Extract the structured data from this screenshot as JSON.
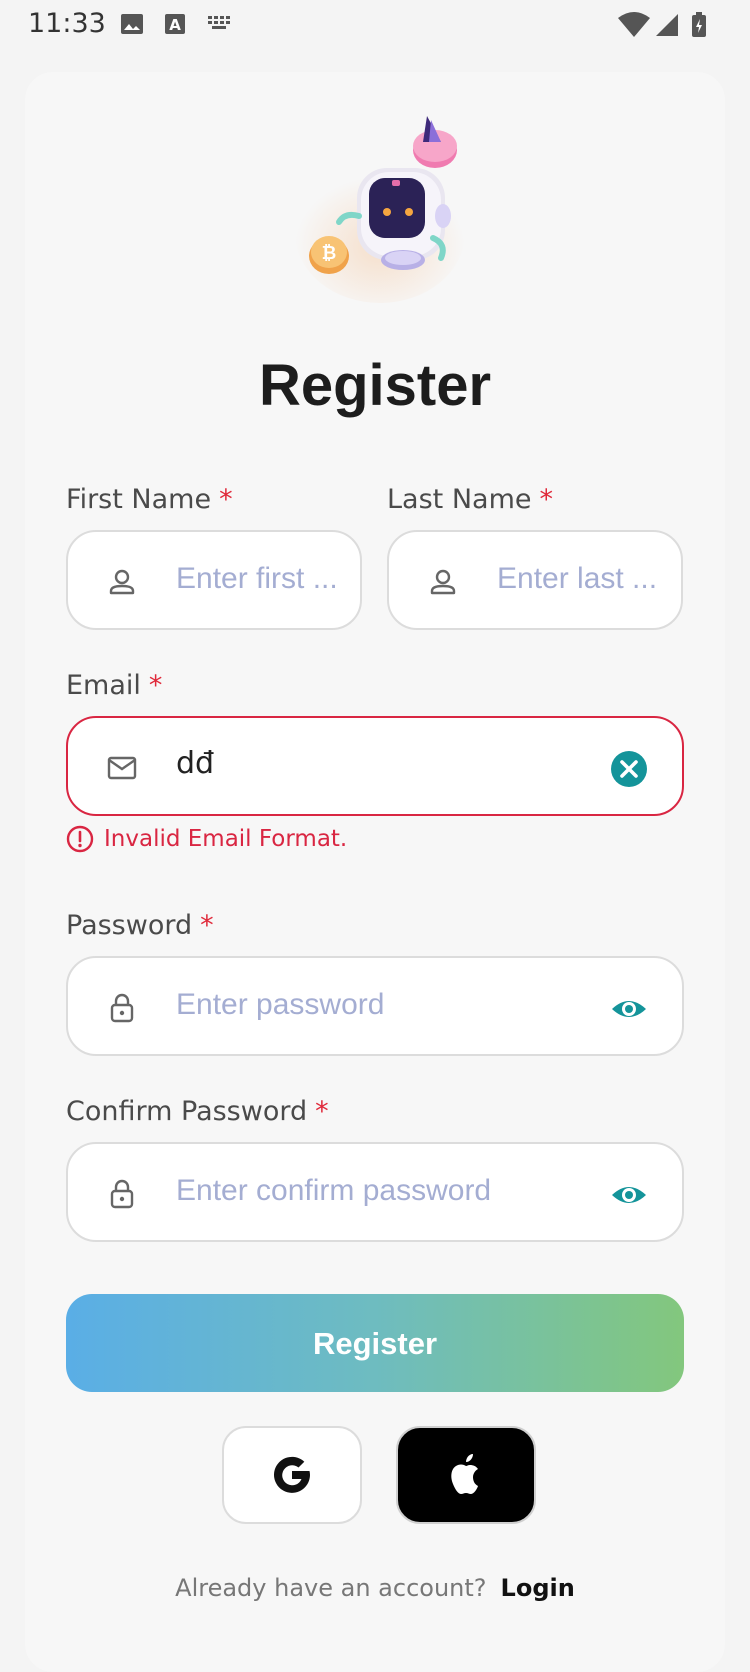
{
  "status_bar": {
    "time": "11:33",
    "icons": [
      "image-icon",
      "text-a-icon",
      "keyboard-icon",
      "wifi-icon",
      "signal-icon",
      "battery-icon"
    ]
  },
  "header": {
    "title": "Register"
  },
  "form": {
    "required_mark": "*",
    "first_name": {
      "label": "First Name",
      "placeholder": "Enter first ...",
      "icon": "user-icon"
    },
    "last_name": {
      "label": "Last Name",
      "placeholder": "Enter last ...",
      "icon": "user-icon"
    },
    "email": {
      "label": "Email",
      "value": "dđ",
      "icon": "mail-icon",
      "error": "Invalid Email Format."
    },
    "password": {
      "label": "Password",
      "placeholder": "Enter password",
      "icon": "lock-icon"
    },
    "confirm_password": {
      "label": "Confirm Password",
      "placeholder": "Enter confirm password",
      "icon": "lock-icon"
    }
  },
  "actions": {
    "register_label": "Register",
    "social": [
      "google-icon",
      "apple-icon"
    ]
  },
  "footer": {
    "prompt": "Already have an account?",
    "login_label": "Login"
  },
  "colors": {
    "accent": "#14949a",
    "error": "#d92642",
    "placeholder": "#a4add2",
    "gradient_start": "#5aaee6",
    "gradient_end": "#83c77d"
  }
}
